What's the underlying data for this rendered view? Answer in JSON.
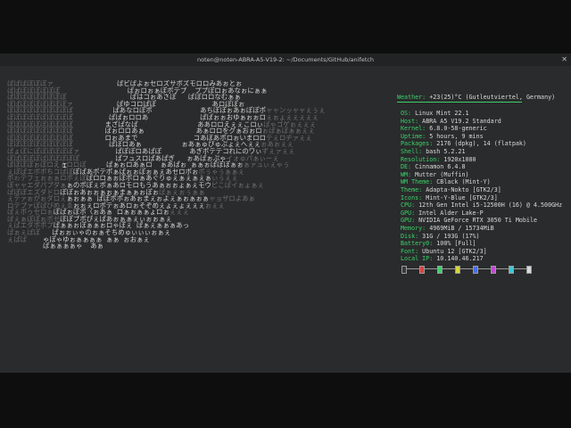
{
  "window": {
    "title": "noten@noten-ABRA-A5-V19-2: ~/Documents/GitHub/anifetch",
    "close_glyph": "✕"
  },
  "weather": {
    "key": "Weather:",
    "value": " +23(25)°C (Gutleutviertel, Germany)"
  },
  "info": [
    {
      "key": "OS:",
      "value": " Linux Mint 22.1"
    },
    {
      "key": "Host:",
      "value": " ABRA A5 V19.2 Standard"
    },
    {
      "key": "Kernel:",
      "value": " 6.8.0-58-generic"
    },
    {
      "key": "Uptime:",
      "value": " 5 hours, 9 mins"
    },
    {
      "key": "Packages:",
      "value": " 2176 (dpkg), 14 (flatpak)"
    },
    {
      "key": "Shell:",
      "value": " bash 5.2.21"
    },
    {
      "key": "Resolution:",
      "value": " 1920x1080"
    },
    {
      "key": "DE:",
      "value": " Cinnamon 6.4.8"
    },
    {
      "key": "WM:",
      "value": " Mutter (Muffin)"
    },
    {
      "key": "WM Theme:",
      "value": " CBlack (Mint-Y)"
    },
    {
      "key": "Theme:",
      "value": " Adapta-Nokto [GTK2/3]"
    },
    {
      "key": "Icons:",
      "value": " Mint-Y-Blue [GTK2/3]"
    },
    {
      "key": "CPU:",
      "value": " 12th Gen Intel i5-12500H (16) @ 4.500GHz"
    },
    {
      "key": "GPU:",
      "value": " Intel Alder Lake-P"
    },
    {
      "key": "GPU:",
      "value": " NVIDIA GeForce RTX 3050 Ti Mobile"
    },
    {
      "key": "Memory:",
      "value": " 4969MiB / 15734MiB"
    },
    {
      "key": "Disk:",
      "value": " 31G / 193G (17%)"
    },
    {
      "key": "Battery0:",
      "value": " 100% [Full]"
    },
    {
      "key": "Font:",
      "value": " Ubuntu 12 [GTK2/3]"
    },
    {
      "key": "Local IP:",
      "value": " 10.140.46.217"
    }
  ],
  "palette": {
    "colors": [
      "#3a3a3a",
      "#e04040",
      "#3bd16a",
      "#d6d63a",
      "#4a6ee0",
      "#c04ad0",
      "#40c8d8",
      "#d8d8d8"
    ]
  },
  "art": {
    "rows": [
      [
        [
          "d",
          "ぱぱぱぽぽぽァ            "
        ],
        [
          "b",
          "    ぱビぱよぉセロズサポズモロロみあぉとぉ      "
        ],
        [
          "d",
          "           "
        ]
      ],
      [
        [
          "d",
          "ぱぱぽぽぽぽぽぽ          "
        ],
        [
          "b",
          "       ぱぉロぉぁぽポテプ  ププぽロぉあなぉにぁぁ  "
        ],
        [
          "d",
          "           "
        ]
      ],
      [
        [
          "d",
          "ぱぽぱぽぽぽぽぽぽ        "
        ],
        [
          "b",
          "        ぱはコぉあさぽ   ぱぽロロなむぁぁ     "
        ],
        [
          "d",
          "           "
        ]
      ],
      [
        [
          "d",
          "ぽぱぽぽぽぽぽぽぽァ      "
        ],
        [
          "b",
          "     ぱゆコロぱぽ              あロぽぽぉ     "
        ],
        [
          "d",
          "          "
        ]
      ],
      [
        [
          "d",
          "ぽぽぽぽぽぽぽぽぽぱ      "
        ],
        [
          "b",
          "    ぱあなロぽポ            あちぽぽぉあぉぽぽポ"
        ],
        [
          "d",
          "ャャンッャャぇぅぇ"
        ]
      ],
      [
        [
          "d",
          "ぽぽぽぽぽぽぽぽぽぽ      "
        ],
        [
          "b",
          "   ぱぱぉロロあ             ぱぱぉぉおゆぁぉぉロ"
        ],
        [
          "d",
          "ぇぉょぇぇぇぇぇ"
        ]
      ],
      [
        [
          "d",
          "ぽぽぽぽぽぽぽぽぽぽ      "
        ],
        [
          "b",
          "  まざぱなぱ               ああロロえぇぇこロぃ"
        ],
        [
          "d",
          "ぱゃゴゲぉぇぇぇ"
        ]
      ],
      [
        [
          "d",
          "ぽぽぽぽぽぽぽぽぽぽ      "
        ],
        [
          "b",
          "  ぱぉロロあぁ             あぁロロをグぁおぉロ"
        ],
        [
          "d",
          "ぉぱぁぱぁぁぇぇ"
        ]
      ],
      [
        [
          "d",
          "ぽぽぽぽぽぽぽぽぽぽ      "
        ],
        [
          "b",
          "  ロぉあまで              コあぼあポロぉいまロロ"
        ],
        [
          "d",
          "テぇロヂァぇぇ"
        ]
      ],
      [
        [
          "d",
          "ぽぽぽぽぽぽぽぽぽぽ      "
        ],
        [
          "b",
          "   ぱぼロあぁ          ぉあぁゅぴゅぷょぇへぇぇ"
        ],
        [
          "d",
          "ぉあぉぇぇ"
        ]
      ],
      [
        [
          "d",
          "ぱょぽにぽぽぽぽぽぽァ    "
        ],
        [
          "b",
          "     ぱぽぽロあぱぽ       あぎポテテコれにのワぃ"
        ],
        [
          "d",
          "ずぇァぇぇ"
        ]
      ],
      [
        [
          "d",
          "ぽぱぽぽぽぱぽぽぽぽぽ    "
        ],
        [
          "b",
          "     ぱフュスロぱあぱぎ   ぉあぱぉぷゃ"
        ],
        [
          "d",
          "イォゅパぁぃーぇ"
        ]
      ],
      [
        [
          "d",
          "ぱぽぽぽぉぽロえぇロロぽ  "
        ],
        [
          "b",
          "   ぱぁぉロあぁロ  ぁあぱぉ ぁぁぉぱぽぽぁぉ"
        ],
        [
          "d",
          "ぁァュぃぇゃぅ"
        ]
      ],
      [
        [
          "d",
          "ぇぽぱエボポちコぱぽ"
        ],
        [
          "b",
          "ぽぱあポテポぁぱぉぉぽぉぁぇあセロポぉ"
        ],
        [
          "d",
          "ポぅゃぅぁぁぇ"
        ]
      ],
      [
        [
          "d",
          "ポゎテフェぉぉぁロポぇぽ"
        ],
        [
          "b",
          "ぱロロぁぉぽポロぁあぐりゅぇぁぇぁぇぁ"
        ],
        [
          "d",
          "ぃぅぇぇ"
        ]
      ],
      [
        [
          "d",
          "ぽャャエダパプダぁ"
        ],
        [
          "b",
          "ぁのポぽぇポぁあロモロもうあぁぉぉょぁぇモウ"
        ],
        [
          "d",
          "ピこぱイぉょぁぇ"
        ]
      ],
      [
        [
          "d",
          "ぱぽぽエズダドロ"
        ],
        [
          "b",
          "ぽぽぉあぉぉぁぉぁまぁぁぉぽぉ"
        ],
        [
          "d",
          "ぱぁぇぉぅぁぁ"
        ]
      ],
      [
        [
          "d",
          "ぇテァぉがぉダロぇ"
        ],
        [
          "b",
          "ぁぉぁぁ ぱぽポポぉあぉまぇぉよぇぁぉぁぉぁ"
        ],
        [
          "d",
          "ャョザロよあぁ"
        ]
      ],
      [
        [
          "d",
          "ロテプァぽぱびめぇゑ"
        ],
        [
          "b",
          "ぉぉぇロポテぉあロぉそぞめぇょぇょぇぇぇ"
        ],
        [
          "d",
          "ぉぇぇ"
        ]
      ],
      [
        [
          "d",
          "ぱぇポゥセロぉ"
        ],
        [
          "b",
          "ぽぱぉぽポ〈ぉあぁ ロぁぉぁぁょロぉ"
        ],
        [
          "d",
          "ぇぇぇ"
        ]
      ],
      [
        [
          "d",
          "ぱぇぁぽぽぉポゼ"
        ],
        [
          "b",
          "ぼぽプポぴぇぱあぉぁぁぇぃぉぉぁぇ"
        ],
        [
          "d",
          ""
        ]
      ],
      [
        [
          "d",
          "ぇばエダポポプ"
        ],
        [
          "b",
          "ぱぁぁぉぽぁぁぉロゃぽぇ ぱぁぇぁぁぁあっ"
        ],
        [
          "d",
          ""
        ]
      ],
      [
        [
          "d",
          "ぱぉぇぱぽ "
        ],
        [
          "b",
          "  ぱぉぉぃゃのぉぁそちめゅぃぃぃぉぁぇ"
        ],
        [
          "d",
          ""
        ]
      ],
      [
        [
          "d",
          "ぇぱぱ  "
        ],
        [
          "b",
          "  ゃぽゃゆぉぁぁぁぁ ぁぁ ぉおぁぇ"
        ],
        [
          "d",
          ""
        ]
      ],
      [
        [
          "d",
          "      "
        ],
        [
          "b",
          "   ぱぁぁぁぁゃ  あぁ"
        ],
        [
          "d",
          ""
        ]
      ]
    ]
  }
}
